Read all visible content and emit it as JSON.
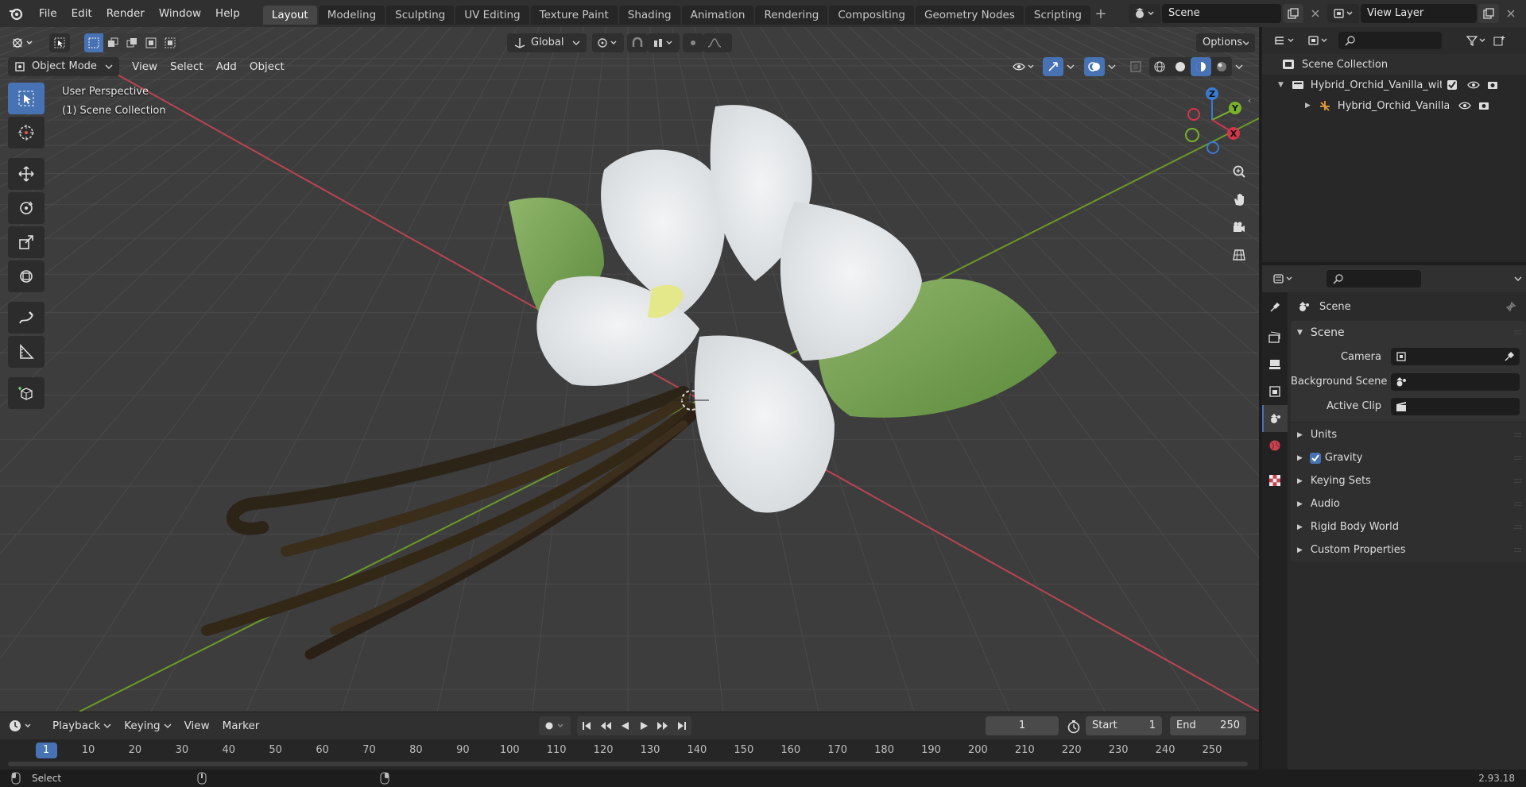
{
  "topbar": {
    "menus": [
      "File",
      "Edit",
      "Render",
      "Window",
      "Help"
    ],
    "workspaces": [
      "Layout",
      "Modeling",
      "Sculpting",
      "UV Editing",
      "Texture Paint",
      "Shading",
      "Animation",
      "Rendering",
      "Compositing",
      "Geometry Nodes",
      "Scripting"
    ],
    "active_workspace": "Layout",
    "add_tab": "+",
    "scene_name": "Scene",
    "view_layer_name": "View Layer"
  },
  "viewport": {
    "mode": "Object Mode",
    "menus": [
      "View",
      "Select",
      "Add",
      "Object"
    ],
    "transform_orientation": "Global",
    "options_label": "Options",
    "perspective_label": "User Perspective",
    "collection_label": "(1) Scene Collection",
    "gizmo_axes": {
      "x": "X",
      "y": "Y",
      "z": "Z"
    },
    "accent_color": "#4772b3",
    "grid_color": "#484848",
    "x_axis_color": "#b8454f",
    "y_axis_color": "#6a9a2a"
  },
  "timeline": {
    "menus": [
      "Playback",
      "Keying",
      "View",
      "Marker"
    ],
    "current_frame": "1",
    "start_label": "Start",
    "start_value": "1",
    "end_label": "End",
    "end_value": "250",
    "ruler": [
      "1",
      "10",
      "20",
      "30",
      "40",
      "50",
      "60",
      "70",
      "80",
      "90",
      "100",
      "110",
      "120",
      "130",
      "140",
      "150",
      "160",
      "170",
      "180",
      "190",
      "200",
      "210",
      "220",
      "230",
      "240",
      "250"
    ]
  },
  "statusbar": {
    "left_label": "Select",
    "version": "2.93.18"
  },
  "outliner": {
    "root": "Scene Collection",
    "items": [
      {
        "label": "Hybrid_Orchid_Vanilla_with_V"
      },
      {
        "label": "Hybrid_Orchid_Vanilla_w"
      }
    ]
  },
  "properties": {
    "context": "Scene",
    "panel_title": "Scene",
    "fields": {
      "camera": "Camera",
      "background_scene": "Background Scene",
      "active_clip": "Active Clip"
    },
    "sections": [
      "Units",
      "Gravity",
      "Keying Sets",
      "Audio",
      "Rigid Body World",
      "Custom Properties"
    ],
    "gravity_checked": true
  }
}
